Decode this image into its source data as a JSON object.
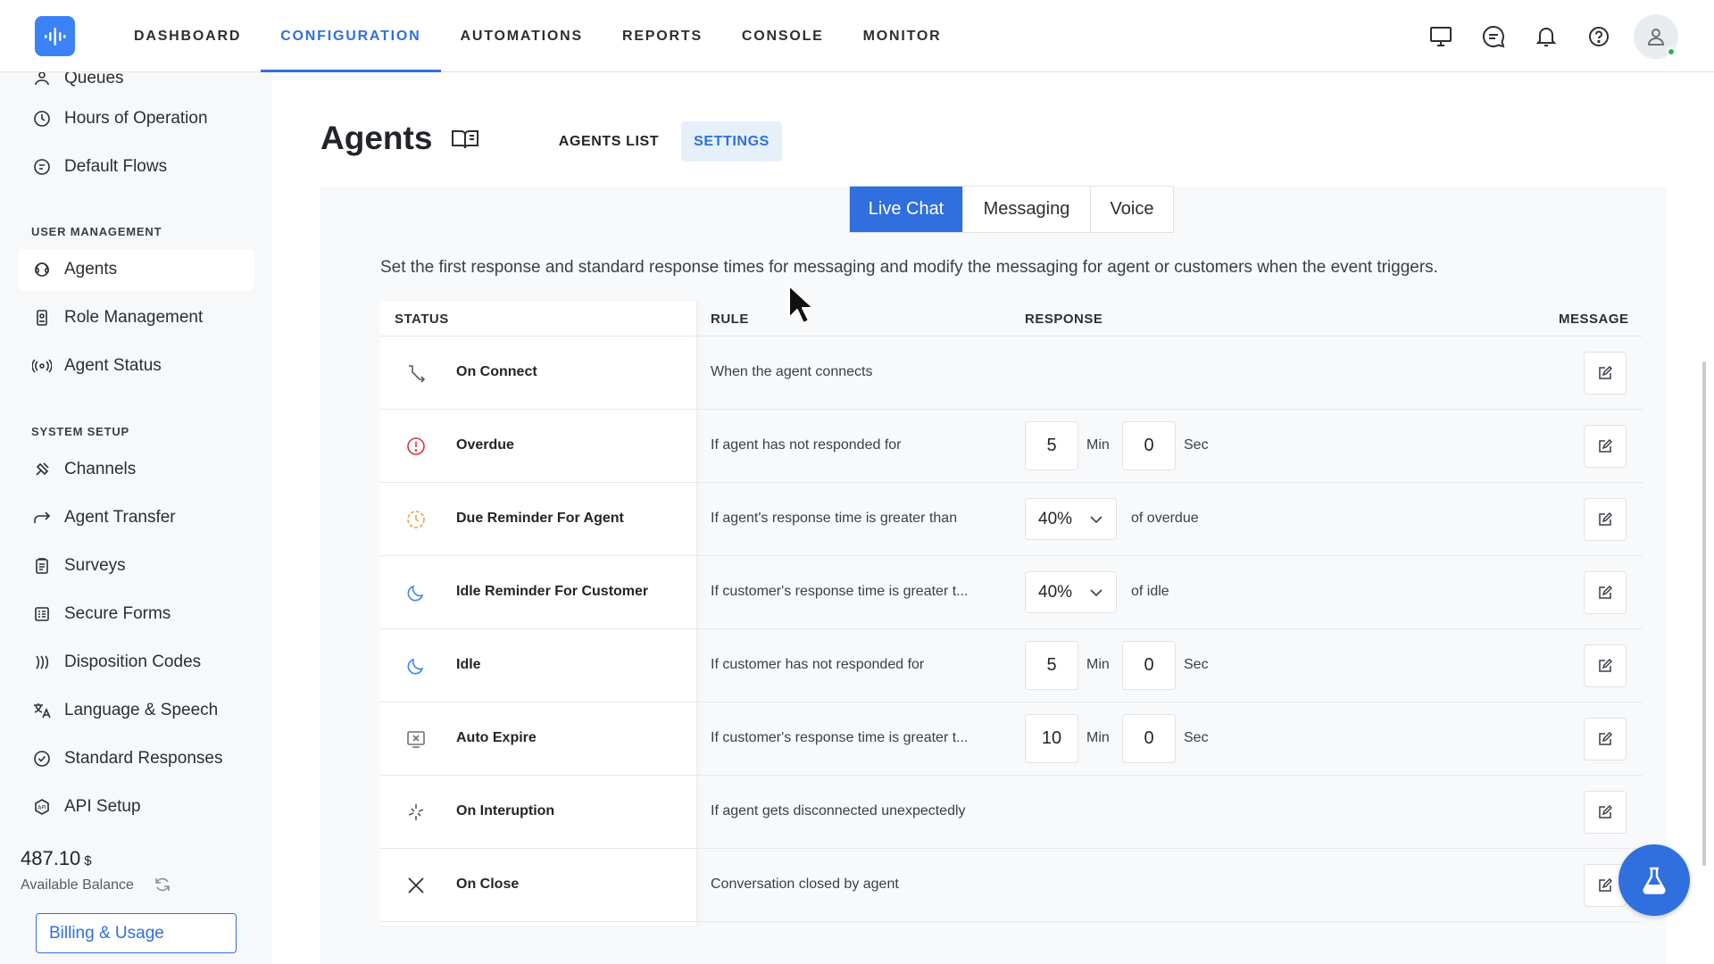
{
  "nav": {
    "items": [
      "DASHBOARD",
      "CONFIGURATION",
      "AUTOMATIONS",
      "REPORTS",
      "CONSOLE",
      "MONITOR"
    ],
    "active": "CONFIGURATION"
  },
  "top_icons": [
    "monitor-icon",
    "chat-icon",
    "bell-icon",
    "help-icon"
  ],
  "sidebar": {
    "partial_item": "Queues",
    "items_top": [
      {
        "label": "Hours of Operation",
        "icon": "clock-icon"
      },
      {
        "label": "Default Flows",
        "icon": "flow-icon"
      }
    ],
    "section_user": "USER MANAGEMENT",
    "items_user": [
      {
        "label": "Agents",
        "icon": "agent-icon"
      },
      {
        "label": "Role Management",
        "icon": "badge-icon"
      },
      {
        "label": "Agent Status",
        "icon": "broadcast-icon"
      }
    ],
    "section_system": "SYSTEM SETUP",
    "items_system": [
      {
        "label": "Channels",
        "icon": "channels-icon"
      },
      {
        "label": "Agent Transfer",
        "icon": "transfer-icon"
      },
      {
        "label": "Surveys",
        "icon": "clipboard-icon"
      },
      {
        "label": "Secure Forms",
        "icon": "form-icon"
      },
      {
        "label": "Disposition Codes",
        "icon": "disposition-icon"
      },
      {
        "label": "Language & Speech",
        "icon": "translate-icon"
      },
      {
        "label": "Standard Responses",
        "icon": "check-circle-icon"
      },
      {
        "label": "API Setup",
        "icon": "api-icon"
      }
    ],
    "active": "Agents"
  },
  "balance": {
    "amount": "487.10",
    "currency": "$",
    "label": "Available Balance",
    "billing_button": "Billing & Usage"
  },
  "page": {
    "title": "Agents",
    "tabs": [
      "AGENTS LIST",
      "SETTINGS"
    ],
    "active_tab": "SETTINGS"
  },
  "channel_tabs": {
    "items": [
      "Live Chat",
      "Messaging",
      "Voice"
    ],
    "active": "Live Chat"
  },
  "description": "Set the first response and standard response times for messaging and modify the messaging for agent or customers when the event triggers.",
  "table": {
    "headers": {
      "status": "STATUS",
      "rule": "RULE",
      "response": "RESPONSE",
      "message": "MESSAGE"
    },
    "rows": [
      {
        "status": "On Connect",
        "icon": "connect-icon",
        "rule": "When the agent connects",
        "type": "none"
      },
      {
        "status": "Overdue",
        "icon": "alert-circle-icon",
        "rule": "If agent has not responded for",
        "type": "time",
        "min": "5",
        "sec": "0"
      },
      {
        "status": "Due Reminder For Agent",
        "icon": "timer-icon",
        "rule": "If agent's response time is greater than",
        "type": "percent",
        "percent": "40%",
        "suffix": "of overdue"
      },
      {
        "status": "Idle Reminder For Customer",
        "icon": "moon-icon",
        "rule": "If customer's response time is greater t...",
        "type": "percent",
        "percent": "40%",
        "suffix": "of idle"
      },
      {
        "status": "Idle",
        "icon": "moon-icon",
        "rule": "If customer has not responded for",
        "type": "time",
        "min": "5",
        "sec": "0"
      },
      {
        "status": "Auto Expire",
        "icon": "expire-icon",
        "rule": "If customer's response time is greater t...",
        "type": "time",
        "min": "10",
        "sec": "0"
      },
      {
        "status": "On Interuption",
        "icon": "interruption-icon",
        "rule": "If agent gets disconnected unexpectedly",
        "type": "none"
      },
      {
        "status": "On Close",
        "icon": "close-icon",
        "rule": "Conversation closed by agent",
        "type": "none"
      }
    ],
    "units": {
      "min": "Min",
      "sec": "Sec"
    }
  },
  "colors": {
    "accent": "#2f6fde",
    "logo": "#3b82f6",
    "online": "#22b55a",
    "alert": "#d9363e",
    "warning": "#f0a050"
  }
}
